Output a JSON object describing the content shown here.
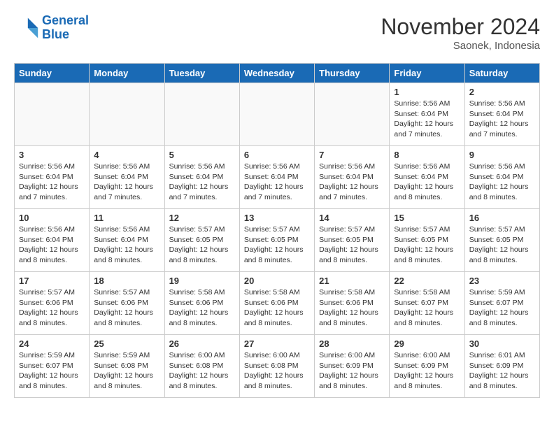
{
  "header": {
    "logo_line1": "General",
    "logo_line2": "Blue",
    "month_title": "November 2024",
    "location": "Saonek, Indonesia"
  },
  "weekdays": [
    "Sunday",
    "Monday",
    "Tuesday",
    "Wednesday",
    "Thursday",
    "Friday",
    "Saturday"
  ],
  "weeks": [
    [
      {
        "day": "",
        "info": ""
      },
      {
        "day": "",
        "info": ""
      },
      {
        "day": "",
        "info": ""
      },
      {
        "day": "",
        "info": ""
      },
      {
        "day": "",
        "info": ""
      },
      {
        "day": "1",
        "info": "Sunrise: 5:56 AM\nSunset: 6:04 PM\nDaylight: 12 hours and 7 minutes."
      },
      {
        "day": "2",
        "info": "Sunrise: 5:56 AM\nSunset: 6:04 PM\nDaylight: 12 hours and 7 minutes."
      }
    ],
    [
      {
        "day": "3",
        "info": "Sunrise: 5:56 AM\nSunset: 6:04 PM\nDaylight: 12 hours and 7 minutes."
      },
      {
        "day": "4",
        "info": "Sunrise: 5:56 AM\nSunset: 6:04 PM\nDaylight: 12 hours and 7 minutes."
      },
      {
        "day": "5",
        "info": "Sunrise: 5:56 AM\nSunset: 6:04 PM\nDaylight: 12 hours and 7 minutes."
      },
      {
        "day": "6",
        "info": "Sunrise: 5:56 AM\nSunset: 6:04 PM\nDaylight: 12 hours and 7 minutes."
      },
      {
        "day": "7",
        "info": "Sunrise: 5:56 AM\nSunset: 6:04 PM\nDaylight: 12 hours and 7 minutes."
      },
      {
        "day": "8",
        "info": "Sunrise: 5:56 AM\nSunset: 6:04 PM\nDaylight: 12 hours and 8 minutes."
      },
      {
        "day": "9",
        "info": "Sunrise: 5:56 AM\nSunset: 6:04 PM\nDaylight: 12 hours and 8 minutes."
      }
    ],
    [
      {
        "day": "10",
        "info": "Sunrise: 5:56 AM\nSunset: 6:04 PM\nDaylight: 12 hours and 8 minutes."
      },
      {
        "day": "11",
        "info": "Sunrise: 5:56 AM\nSunset: 6:04 PM\nDaylight: 12 hours and 8 minutes."
      },
      {
        "day": "12",
        "info": "Sunrise: 5:57 AM\nSunset: 6:05 PM\nDaylight: 12 hours and 8 minutes."
      },
      {
        "day": "13",
        "info": "Sunrise: 5:57 AM\nSunset: 6:05 PM\nDaylight: 12 hours and 8 minutes."
      },
      {
        "day": "14",
        "info": "Sunrise: 5:57 AM\nSunset: 6:05 PM\nDaylight: 12 hours and 8 minutes."
      },
      {
        "day": "15",
        "info": "Sunrise: 5:57 AM\nSunset: 6:05 PM\nDaylight: 12 hours and 8 minutes."
      },
      {
        "day": "16",
        "info": "Sunrise: 5:57 AM\nSunset: 6:05 PM\nDaylight: 12 hours and 8 minutes."
      }
    ],
    [
      {
        "day": "17",
        "info": "Sunrise: 5:57 AM\nSunset: 6:06 PM\nDaylight: 12 hours and 8 minutes."
      },
      {
        "day": "18",
        "info": "Sunrise: 5:57 AM\nSunset: 6:06 PM\nDaylight: 12 hours and 8 minutes."
      },
      {
        "day": "19",
        "info": "Sunrise: 5:58 AM\nSunset: 6:06 PM\nDaylight: 12 hours and 8 minutes."
      },
      {
        "day": "20",
        "info": "Sunrise: 5:58 AM\nSunset: 6:06 PM\nDaylight: 12 hours and 8 minutes."
      },
      {
        "day": "21",
        "info": "Sunrise: 5:58 AM\nSunset: 6:06 PM\nDaylight: 12 hours and 8 minutes."
      },
      {
        "day": "22",
        "info": "Sunrise: 5:58 AM\nSunset: 6:07 PM\nDaylight: 12 hours and 8 minutes."
      },
      {
        "day": "23",
        "info": "Sunrise: 5:59 AM\nSunset: 6:07 PM\nDaylight: 12 hours and 8 minutes."
      }
    ],
    [
      {
        "day": "24",
        "info": "Sunrise: 5:59 AM\nSunset: 6:07 PM\nDaylight: 12 hours and 8 minutes."
      },
      {
        "day": "25",
        "info": "Sunrise: 5:59 AM\nSunset: 6:08 PM\nDaylight: 12 hours and 8 minutes."
      },
      {
        "day": "26",
        "info": "Sunrise: 6:00 AM\nSunset: 6:08 PM\nDaylight: 12 hours and 8 minutes."
      },
      {
        "day": "27",
        "info": "Sunrise: 6:00 AM\nSunset: 6:08 PM\nDaylight: 12 hours and 8 minutes."
      },
      {
        "day": "28",
        "info": "Sunrise: 6:00 AM\nSunset: 6:09 PM\nDaylight: 12 hours and 8 minutes."
      },
      {
        "day": "29",
        "info": "Sunrise: 6:00 AM\nSunset: 6:09 PM\nDaylight: 12 hours and 8 minutes."
      },
      {
        "day": "30",
        "info": "Sunrise: 6:01 AM\nSunset: 6:09 PM\nDaylight: 12 hours and 8 minutes."
      }
    ]
  ]
}
